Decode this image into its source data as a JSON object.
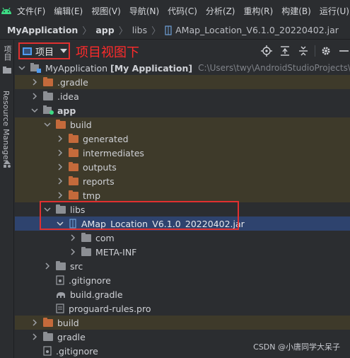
{
  "menubar": {
    "items": [
      "文件(F)",
      "编辑(E)",
      "视图(V)",
      "导航(N)",
      "代码(C)",
      "分析(Z)",
      "重构(R)",
      "构建(B)",
      "运行(U)"
    ]
  },
  "breadcrumbs": {
    "project": "MyApplication",
    "module": "app",
    "folder": "libs",
    "file": "AMap_Location_V6.1.0_20220402.jar"
  },
  "sidestrip": {
    "project_tab": "项目",
    "resource_tab": "Resource Manager"
  },
  "toolbar": {
    "view_label": "项目",
    "annotation": "项目视图下"
  },
  "tree": {
    "root_name": "MyApplication",
    "root_module": "[My Application]",
    "root_path": "C:\\Users\\twy\\AndroidStudioProjects\\MyA",
    "items": [
      ".gradle",
      ".idea",
      "app",
      "build",
      "generated",
      "intermediates",
      "outputs",
      "reports",
      "tmp",
      "libs",
      "AMap_Location_V6.1.0_20220402.jar",
      "com",
      "META-INF",
      "src",
      ".gitignore",
      "build.gradle",
      "proguard-rules.pro",
      "build",
      "gradle",
      ".gitignore"
    ]
  },
  "watermark": "CSDN @小唐同学大呆子",
  "colors": {
    "background": "#2b2d30",
    "selection": "#2e436e",
    "highlight": "#3e3a2a",
    "folder_orange": "#c46a3b",
    "annotation_red": "#ff2b2b"
  }
}
